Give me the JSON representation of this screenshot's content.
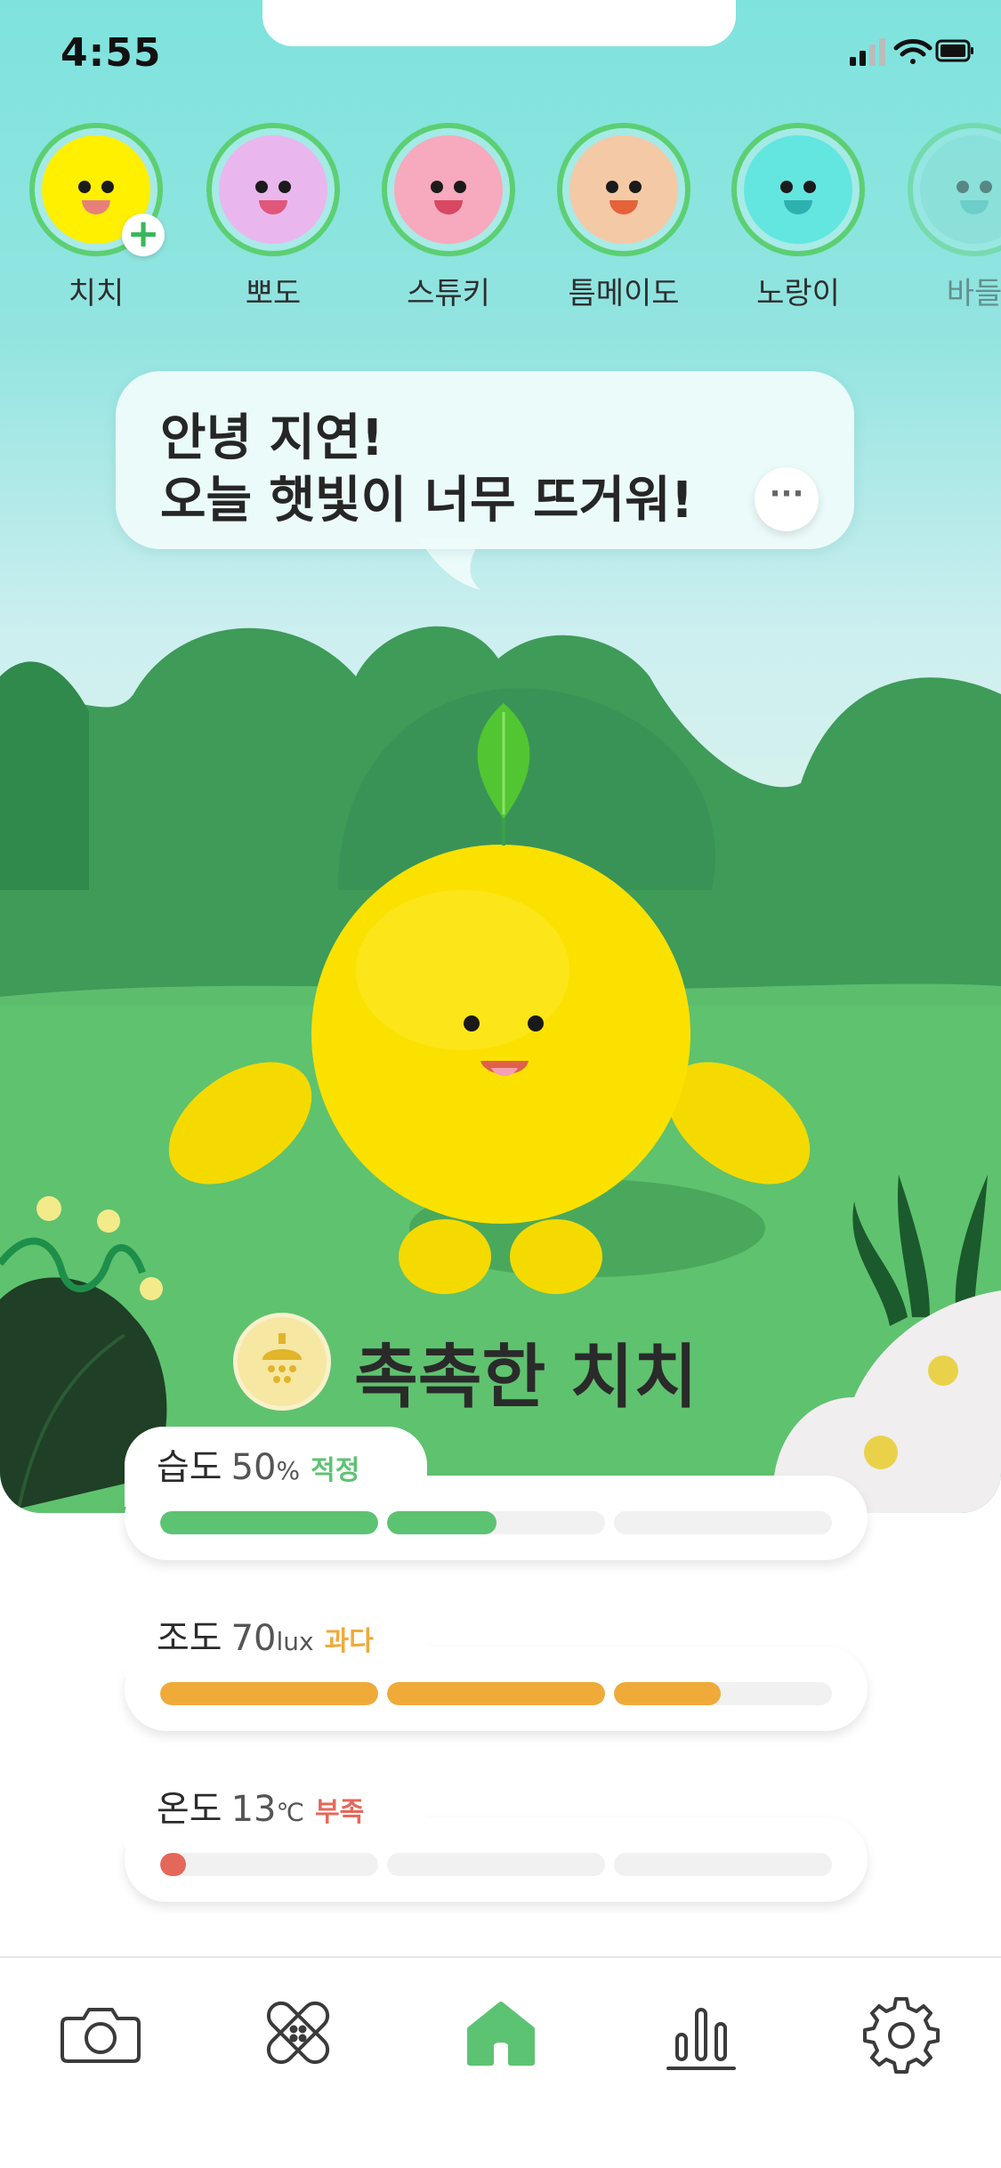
{
  "status_bar": {
    "time": "4:55"
  },
  "characters": [
    {
      "name": "치치",
      "face_color": "#fff000",
      "mouth_color": "#e8807a",
      "has_add": true,
      "faded": false
    },
    {
      "name": "뽀도",
      "face_color": "#eab6ee",
      "mouth_color": "#e0577a",
      "has_add": false,
      "faded": false
    },
    {
      "name": "스튜키",
      "face_color": "#f7a9bd",
      "mouth_color": "#d94862",
      "has_add": false,
      "faded": false
    },
    {
      "name": "틈메이도",
      "face_color": "#f4c9a6",
      "mouth_color": "#e5623a",
      "has_add": false,
      "faded": false
    },
    {
      "name": "노랑이",
      "face_color": "#63e6e0",
      "mouth_color": "#2fb0b0",
      "has_add": false,
      "faded": false
    },
    {
      "name": "바들",
      "face_color": "#8fdcd6",
      "mouth_color": "#4ab4b0",
      "has_add": false,
      "faded": true
    }
  ],
  "speech": {
    "line1": "안녕 지연!",
    "line2": "오늘 햇빛이 너무 뜨거워!",
    "more_label": "···"
  },
  "plant_status": {
    "title": "촉촉한 치치",
    "icon": "shower-icon"
  },
  "metrics": [
    {
      "label": "습도",
      "value": "50",
      "unit": "%",
      "status": "적정",
      "status_color": "#5cc373",
      "bar_color": "#5cc373",
      "level": 0.5
    },
    {
      "label": "조도",
      "value": "70",
      "unit": "lux",
      "status": "과다",
      "status_color": "#f0aa3a",
      "bar_color": "#f0aa3a",
      "level": 0.83
    },
    {
      "label": "온도",
      "value": "13",
      "unit": "℃",
      "status": "부족",
      "status_color": "#e4685a",
      "bar_color": "#e4685a",
      "level": 0.04
    }
  ],
  "tabbar": [
    {
      "icon": "camera-icon",
      "active": false
    },
    {
      "icon": "bandage-icon",
      "active": false
    },
    {
      "icon": "home-icon",
      "active": true
    },
    {
      "icon": "bar-chart-icon",
      "active": false
    },
    {
      "icon": "gear-icon",
      "active": false
    }
  ],
  "colors": {
    "active": "#5cc373",
    "inactive": "#3b3b3b",
    "ring": "#5ccf73"
  }
}
